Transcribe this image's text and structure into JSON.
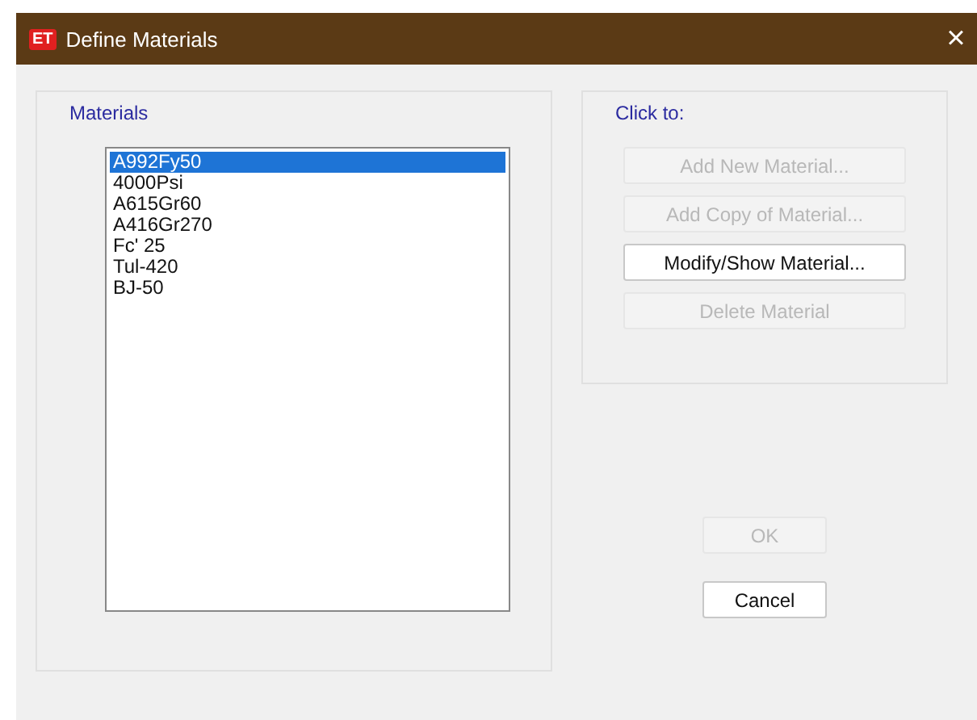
{
  "window": {
    "icon_text": "ET",
    "title": "Define Materials",
    "close": "×"
  },
  "materials": {
    "label": "Materials",
    "items": [
      {
        "name": "A992Fy50",
        "selected": true
      },
      {
        "name": "4000Psi",
        "selected": false
      },
      {
        "name": "A615Gr60",
        "selected": false
      },
      {
        "name": "A416Gr270",
        "selected": false
      },
      {
        "name": "Fc' 25",
        "selected": false
      },
      {
        "name": "Tul-420",
        "selected": false
      },
      {
        "name": "BJ-50",
        "selected": false
      }
    ]
  },
  "actions": {
    "label": "Click to:",
    "buttons": [
      {
        "label": "Add New Material...",
        "disabled": true
      },
      {
        "label": "Add Copy of Material...",
        "disabled": true
      },
      {
        "label": "Modify/Show Material...",
        "disabled": false
      },
      {
        "label": "Delete Material",
        "disabled": true
      }
    ]
  },
  "dialog_buttons": [
    {
      "label": "OK",
      "disabled": true
    },
    {
      "label": "Cancel",
      "disabled": false
    }
  ]
}
